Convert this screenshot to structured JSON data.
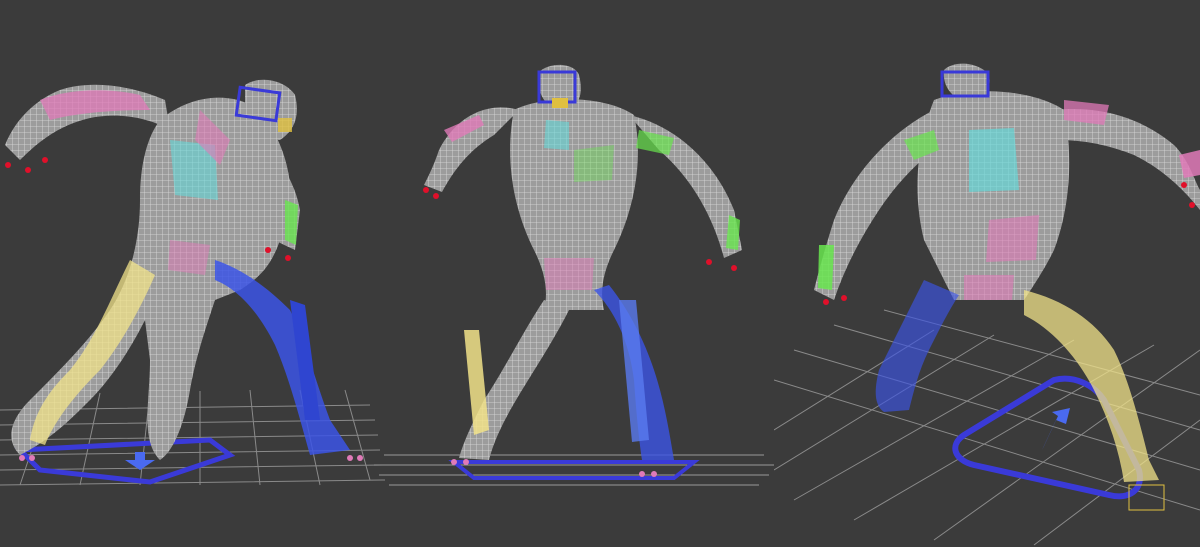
{
  "viewports": [
    {
      "id": "left",
      "view": "front-three-quarter",
      "grid": true
    },
    {
      "id": "middle",
      "view": "front",
      "grid": true
    },
    {
      "id": "right",
      "view": "back-three-quarter",
      "grid": true
    }
  ],
  "colors": {
    "background": "#3b3b3b",
    "mesh": "#c9c9c9",
    "grid": "#8a8a8a",
    "bone_blue": "#3c55e6",
    "bone_yellow": "#f2e38a",
    "bone_pink": "#e07ab8",
    "bone_green": "#69e64f",
    "bone_cyan": "#66d9d9",
    "control_ring": "#3a3ad8",
    "finger_tips": "#e0102a"
  }
}
